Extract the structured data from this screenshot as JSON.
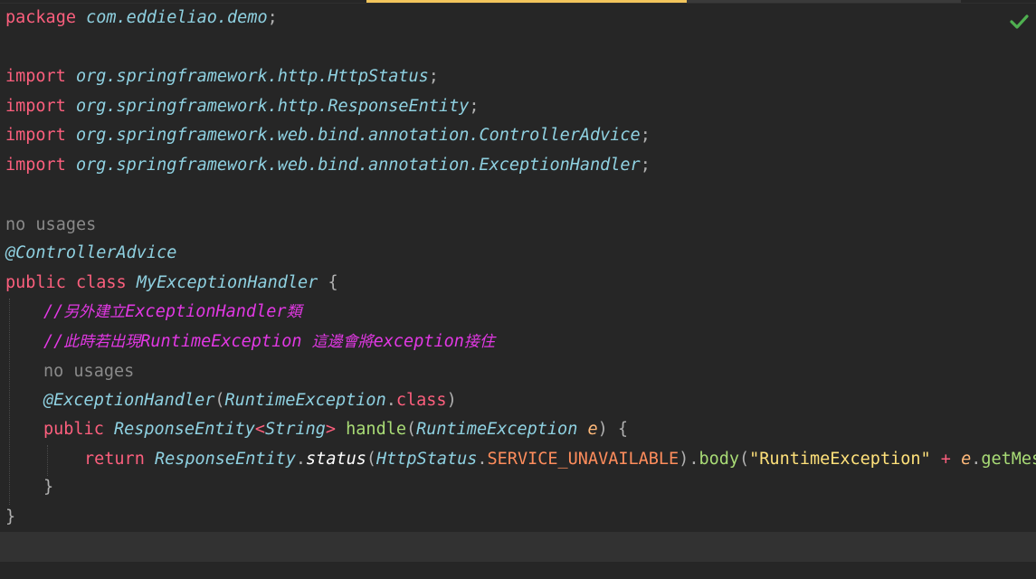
{
  "editor": {
    "status_icon": "checkmark-icon",
    "status_color": "#4fb050",
    "lines": {
      "package_kw": "package",
      "package_name": "com.eddieliao.demo",
      "semicolon": ";",
      "import_kw": "import",
      "import_1": "org.springframework.http.HttpStatus",
      "import_2": "org.springframework.http.ResponseEntity",
      "import_3": "org.springframework.web.bind.annotation.ControllerAdvice",
      "import_4": "org.springframework.web.bind.annotation.ExceptionHandler",
      "usage_hint_1": "no usages",
      "class_annotation": "@ControllerAdvice",
      "public_kw": "public",
      "class_kw": "class",
      "class_name": "MyExceptionHandler",
      "open_brace": "{",
      "close_brace": "}",
      "comment_1_slash": "//",
      "comment_1_a": "另外建立",
      "comment_1_b": "ExceptionHandler",
      "comment_1_c": "類",
      "comment_2_slash": "//",
      "comment_2_a": "此時若出現",
      "comment_2_b": "RuntimeException ",
      "comment_2_c": "這邊會將",
      "comment_2_d": "exception",
      "comment_2_e": "接住",
      "usage_hint_2": "no usages",
      "method_annotation": "@ExceptionHandler",
      "paren_open": "(",
      "paren_close": ")",
      "runtime_exception": "RuntimeException",
      "dot": ".",
      "class_literal": "class",
      "response_entity": "ResponseEntity",
      "lt": "<",
      "string_type": "String",
      "gt": ">",
      "method_name": "handle",
      "param_name": "e",
      "return_kw": "return",
      "status_method": "status",
      "http_status": "HttpStatus",
      "service_unavailable": "SERVICE_UNAVAILABLE",
      "body_method": "body",
      "string_literal": "\"RuntimeException\"",
      "plus": "+",
      "get_message": "getMess"
    }
  }
}
